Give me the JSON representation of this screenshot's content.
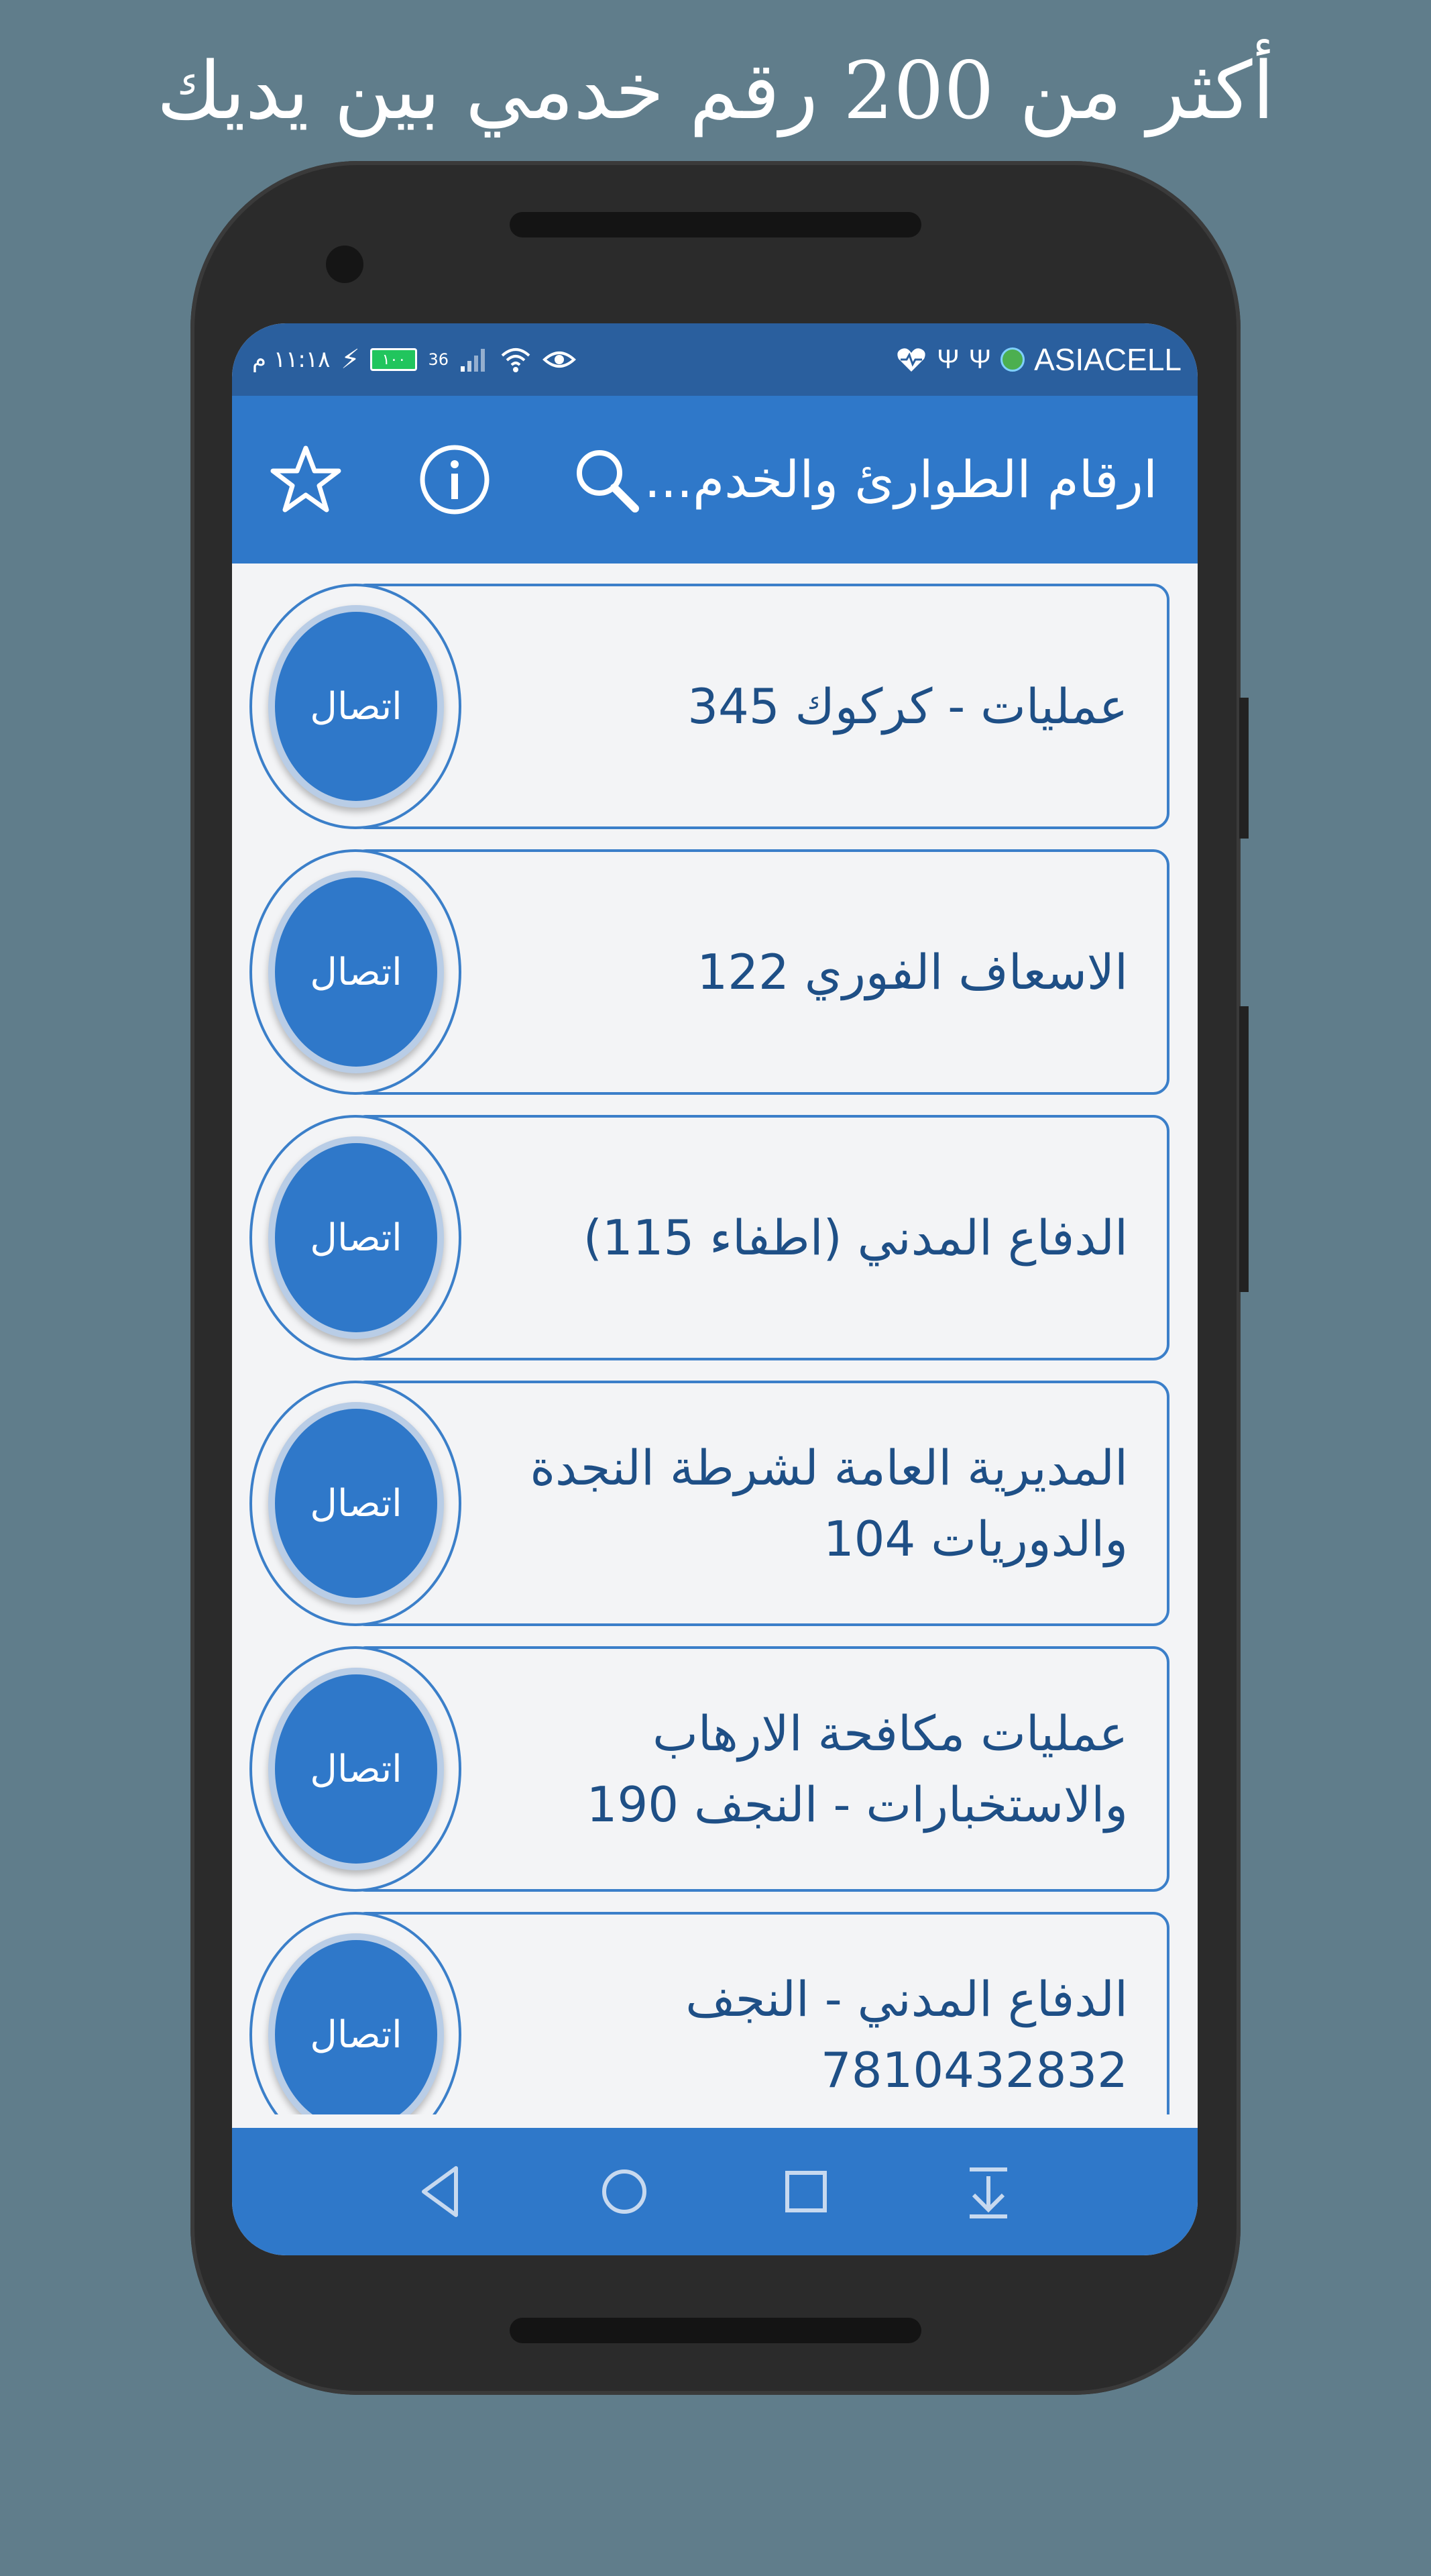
{
  "promo": {
    "headline": "أكثر من 200 رقم خدمي بين يديك"
  },
  "status_bar": {
    "carrier": "ASIACELL",
    "time": "١١:١٨ م",
    "battery": "١٠٠",
    "signal_label": "36"
  },
  "app_bar": {
    "title": "ارقام الطوارئ والخدم...",
    "icons": [
      "search-icon",
      "info-icon",
      "star-icon"
    ]
  },
  "list": {
    "call_label": "اتصال",
    "items": [
      {
        "label": "عمليات - كركوك 345"
      },
      {
        "label": "الاسعاف الفوري 122"
      },
      {
        "label": "الدفاع المدني (اطفاء 115)"
      },
      {
        "label": "المديرية العامة لشرطة النجدة والدوريات 104"
      },
      {
        "label": "عمليات مكافحة الارهاب والاستخبارات - النجف 190"
      },
      {
        "label": "الدفاع المدني - النجف 7810432832"
      }
    ]
  },
  "nav_bar": {
    "icons": [
      "back-icon",
      "home-icon",
      "recents-icon",
      "notification-pull-icon"
    ]
  },
  "colors": {
    "background": "#607d8b",
    "primary": "#2f78c9",
    "status_bar": "#2a5f9e",
    "list_text": "#1e4f86"
  }
}
